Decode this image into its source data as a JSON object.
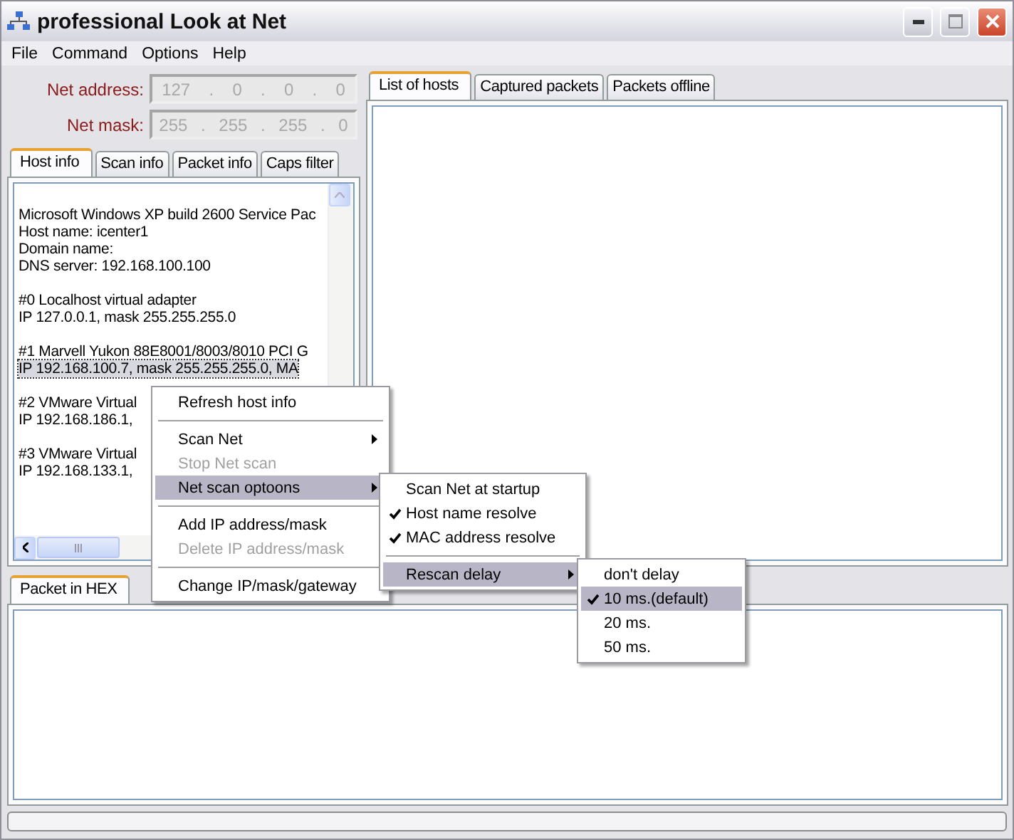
{
  "window": {
    "title": "professional Look at Net"
  },
  "menu_bar": [
    "File",
    "Command",
    "Options",
    "Help"
  ],
  "net_fields": [
    {
      "label": "Net address:",
      "octets": [
        "127",
        "0",
        "0",
        "0"
      ],
      "separator": ".",
      "disabled": true
    },
    {
      "label": "Net mask:",
      "octets": [
        "255",
        "255",
        "255",
        "0"
      ],
      "separator": ".",
      "disabled": true
    }
  ],
  "left_tabs": [
    {
      "label": "Host info",
      "selected": true
    },
    {
      "label": "Scan info",
      "selected": false
    },
    {
      "label": "Packet info",
      "selected": false
    },
    {
      "label": "Caps filter",
      "selected": false
    }
  ],
  "host_info": [
    [
      {
        "text": "Microsoft Windows XP build 2600 Service Pac",
        "selected": false
      },
      {
        "text": "Host name: icenter1",
        "selected": false
      },
      {
        "text": "Domain name:",
        "selected": false
      },
      {
        "text": "DNS server: 192.168.100.100",
        "selected": false
      }
    ],
    [
      {
        "text": "#0 Localhost virtual adapter",
        "selected": false
      },
      {
        "text": "IP 127.0.0.1, mask 255.255.255.0",
        "selected": false
      }
    ],
    [
      {
        "text": "#1 Marvell Yukon 88E8001/8003/8010 PCI G",
        "selected": false
      },
      {
        "text": "IP 192.168.100.7, mask 255.255.255.0, MA",
        "selected": true
      }
    ],
    [
      {
        "text": "#2 VMware Virtual",
        "selected": false
      },
      {
        "text": "IP 192.168.186.1,",
        "selected": false
      }
    ],
    [
      {
        "text": "#3 VMware Virtual",
        "selected": false
      },
      {
        "text": "IP 192.168.133.1,",
        "selected": false
      }
    ]
  ],
  "right_tabs": [
    {
      "label": "List of hosts",
      "selected": true
    },
    {
      "label": "Captured packets",
      "selected": false
    },
    {
      "label": "Packets offline",
      "selected": false
    }
  ],
  "bottom_tabs": [
    {
      "label": "Packet in HEX",
      "selected": true
    }
  ],
  "context_menu": [
    {
      "kind": "item",
      "label": "Refresh host info",
      "disabled": false,
      "highlighted": false,
      "submenu": false
    },
    {
      "kind": "separator"
    },
    {
      "kind": "item",
      "label": "Scan Net",
      "disabled": false,
      "highlighted": false,
      "submenu": true
    },
    {
      "kind": "item",
      "label": "Stop Net scan",
      "disabled": true,
      "highlighted": false,
      "submenu": false
    },
    {
      "kind": "item",
      "label": "Net scan optoons",
      "disabled": false,
      "highlighted": true,
      "submenu": true
    },
    {
      "kind": "separator"
    },
    {
      "kind": "item",
      "label": "Add IP address/mask",
      "disabled": false,
      "highlighted": false,
      "submenu": false
    },
    {
      "kind": "item",
      "label": "Delete IP address/mask",
      "disabled": true,
      "highlighted": false,
      "submenu": false
    },
    {
      "kind": "separator"
    },
    {
      "kind": "item",
      "label": "Change IP/mask/gateway",
      "disabled": false,
      "highlighted": false,
      "submenu": false
    }
  ],
  "scan_options_menu": [
    {
      "kind": "item",
      "label": "Scan Net at startup",
      "checked": false,
      "highlighted": false,
      "submenu": false
    },
    {
      "kind": "item",
      "label": "Host name resolve",
      "checked": true,
      "highlighted": false,
      "submenu": false
    },
    {
      "kind": "item",
      "label": "MAC address resolve",
      "checked": true,
      "highlighted": false,
      "submenu": false
    },
    {
      "kind": "separator"
    },
    {
      "kind": "item",
      "label": "Rescan delay",
      "checked": false,
      "highlighted": true,
      "submenu": true
    }
  ],
  "rescan_delay_menu": [
    {
      "kind": "item",
      "label": "don't delay",
      "checked": false,
      "highlighted": false,
      "submenu": false
    },
    {
      "kind": "item",
      "label": "10 ms.(default)",
      "checked": true,
      "highlighted": true,
      "submenu": false
    },
    {
      "kind": "item",
      "label": "20 ms.",
      "checked": false,
      "highlighted": false,
      "submenu": false
    },
    {
      "kind": "item",
      "label": "50 ms.",
      "checked": false,
      "highlighted": false,
      "submenu": false
    }
  ]
}
